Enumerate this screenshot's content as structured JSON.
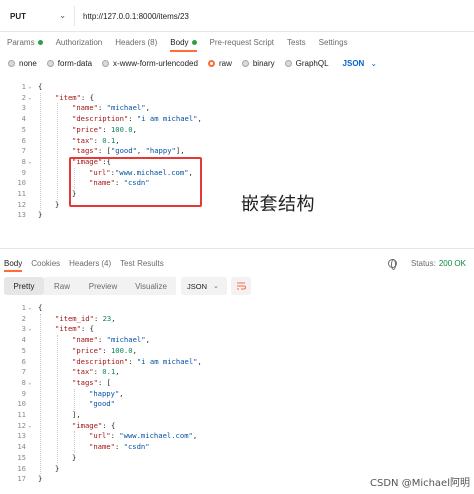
{
  "request": {
    "method": "PUT",
    "url": "http://127.0.0.1:8000/items/23"
  },
  "tabs": [
    {
      "label": "Params",
      "dot": "#2e9e4a"
    },
    {
      "label": "Authorization"
    },
    {
      "label": "Headers",
      "count": "(8)"
    },
    {
      "label": "Body",
      "dot": "#2e9e4a",
      "active": true
    },
    {
      "label": "Pre-request Script"
    },
    {
      "label": "Tests"
    },
    {
      "label": "Settings"
    }
  ],
  "body_types": [
    "none",
    "form-data",
    "x-www-form-urlencoded",
    "raw",
    "binary",
    "GraphQL"
  ],
  "body_type_selected": "raw",
  "body_format": "JSON",
  "annotation": "嵌套结构",
  "request_body_lines": [
    "{",
    "\"item\": {",
    "\"name\": \"michael\",",
    "\"description\": \"i am michael\",",
    "\"price\": 100.0,",
    "\"tax\": 0.1,",
    "\"tags\": [\"good\", \"happy\"],",
    "\"image\":{",
    "\"url\":\"www.michael.com\",",
    "\"name\": \"csdn\"",
    "}",
    "}",
    "}"
  ],
  "response_tabs": [
    "Body",
    "Cookies",
    "Headers",
    "Test Results"
  ],
  "response_headers_count": "(4)",
  "status_label": "Status:",
  "status_value": "200 OK",
  "view_modes": [
    "Pretty",
    "Raw",
    "Preview",
    "Visualize"
  ],
  "response_format": "JSON",
  "response_body_lines": [
    "{",
    "\"item_id\": 23,",
    "\"item\": {",
    "\"name\": \"michael\",",
    "\"price\": 100.0,",
    "\"description\": \"i am michael\",",
    "\"tax\": 0.1,",
    "\"tags\": [",
    "\"happy\",",
    "\"good\"",
    "],",
    "\"image\": {",
    "\"url\": \"www.michael.com\",",
    "\"name\": \"csdn\"",
    "}",
    "}",
    "}"
  ],
  "watermark": "CSDN @Michael阿明",
  "colors": {
    "accent": "#ff6c37",
    "status_ok": "#0c8a3d",
    "highlight": "#e53935",
    "link": "#0265d2"
  }
}
